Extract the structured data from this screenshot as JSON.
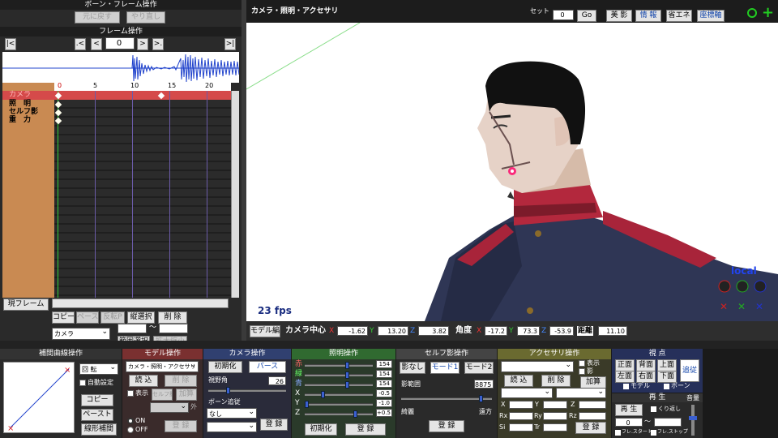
{
  "bone_frame": {
    "title": "ボーン・フレーム操作",
    "undo": "元に戻す",
    "redo": "やり直し",
    "frame_ops": "フレーム操作",
    "frame_value": "0",
    "nav_first": "|<",
    "nav_prev_key": ".<",
    "nav_prev": "<",
    "nav_next": ">",
    "nav_next_key": ">.",
    "nav_last": ">|",
    "ruler": [
      "0",
      "5",
      "10",
      "15",
      "20"
    ],
    "tracks": [
      "カメラ",
      "照　明",
      "セルフ影",
      "重　力"
    ],
    "current_frame_btn": "現フレーム",
    "copy": "コピー",
    "paste": "ペースト",
    "reverse_p": "反転P",
    "vert_select": "縦選択",
    "delete": "削 除",
    "model_select": "カメラ",
    "range_select": "範囲選択",
    "expand": "拡大縮小",
    "range_tilde": "〜"
  },
  "viewport": {
    "title": "カメラ・照明・アクセサリ",
    "set_label": "セット",
    "set_value": "0",
    "go": "Go",
    "toggles": [
      "美 影",
      "情 報",
      "省エネ",
      "座標軸"
    ],
    "fps": "23 fps",
    "local": "local"
  },
  "camera_bar": {
    "model_edit": "モデル編",
    "center_label": "カメラ中心",
    "cx": "-1.62",
    "cy": "13.20",
    "cz": "3.82",
    "angle_label": "角度",
    "ax": "-17.2",
    "ay": "73.3",
    "az": "-53.9",
    "dist_label": "距離",
    "dist": "11.10"
  },
  "interp": {
    "title": "補間曲線操作",
    "select": "回 転",
    "auto": "自動設定",
    "copy": "コピー",
    "paste": "ペースト",
    "linear": "線形補間"
  },
  "model_ops": {
    "title": "モデル操作",
    "select": "カメラ・照明・アクセサリ",
    "load": "読 込",
    "delete": "削 除",
    "show": "表示",
    "self_shadow": "セルフ影",
    "add": "加算",
    "outer": "外",
    "on": "ON",
    "off": "OFF",
    "register": "登 録"
  },
  "camera_ops": {
    "title": "カメラ操作",
    "reset": "初期化",
    "perspective": "パース",
    "fov_label": "視野角",
    "fov": "26",
    "bone_follow": "ボーン追従",
    "none": "なし",
    "register": "登 録"
  },
  "light_ops": {
    "title": "照明操作",
    "r_label": "赤",
    "g_label": "緑",
    "b_label": "青",
    "r": "154",
    "g": "154",
    "b": "154",
    "x_label": "X",
    "y_label": "Y",
    "z_label": "Z",
    "x": "-0.5",
    "y": "-1.0",
    "z": "+0.5",
    "reset": "初期化",
    "register": "登 録"
  },
  "shadow_ops": {
    "title": "セルフ影操作",
    "none": "影なし",
    "mode1": "モード1",
    "mode2": "モード2",
    "range_label": "影範囲",
    "range": "8875",
    "near": "綺麗",
    "far": "遠方",
    "register": "登 録"
  },
  "accessory_ops": {
    "title": "アクセサリ操作",
    "show": "表示",
    "shadow": "影",
    "load": "読 込",
    "delete": "削 除",
    "add": "加算",
    "x": "X",
    "y": "Y",
    "z": "Z",
    "rx": "Rx",
    "ry": "Ry",
    "rz": "Rz",
    "si": "Si",
    "tr": "Tr",
    "register": "登 録"
  },
  "viewpoint": {
    "title": "視 点",
    "front": "正面",
    "back": "背面",
    "top": "上面",
    "left": "左面",
    "right": "右面",
    "bottom": "下面",
    "follow": "追従",
    "model": "モデル",
    "bone": "ボーン"
  },
  "playback": {
    "title": "再 生",
    "play": "再 生",
    "repeat": "くり返し",
    "from": "0",
    "tilde": "〜",
    "frame_start": "フレ.スタート",
    "frame_stop": "フレ.ストップ",
    "volume": "音量"
  }
}
